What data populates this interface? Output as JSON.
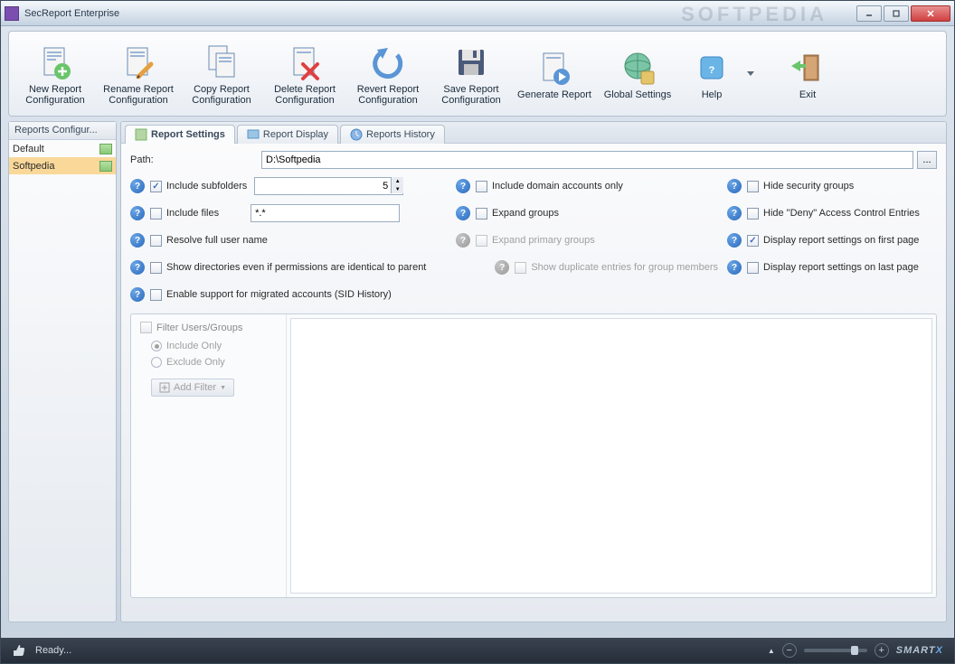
{
  "window": {
    "title": "SecReport Enterprise",
    "watermark": "SOFTPEDIA"
  },
  "toolbar": {
    "items": [
      {
        "label": "New Report Configuration"
      },
      {
        "label": "Rename Report Configuration"
      },
      {
        "label": "Copy Report Configuration"
      },
      {
        "label": "Delete Report Configuration"
      },
      {
        "label": "Revert Report Configuration"
      },
      {
        "label": "Save Report Configuration"
      },
      {
        "label": "Generate Report"
      },
      {
        "label": "Global Settings"
      },
      {
        "label": "Help"
      },
      {
        "label": "Exit"
      }
    ]
  },
  "sidebar": {
    "header": "Reports Configur...",
    "items": [
      {
        "label": "Default"
      },
      {
        "label": "Softpedia"
      }
    ]
  },
  "tabs": [
    {
      "label": "Report Settings"
    },
    {
      "label": "Report Display"
    },
    {
      "label": "Reports History"
    }
  ],
  "path": {
    "label": "Path:",
    "value": "D:\\Softpedia",
    "browse": "..."
  },
  "opts": {
    "include_subfolders": "Include subfolders",
    "subfolder_depth": "5",
    "include_files": "Include files",
    "files_pattern": "*.*",
    "resolve_name": "Resolve full user name",
    "show_identical": "Show directories even if permissions are identical to parent",
    "enable_sid": "Enable support for migrated accounts (SID History)",
    "domain_only": "Include domain accounts only",
    "expand_groups": "Expand  groups",
    "expand_primary": "Expand primary groups",
    "show_duplicate": "Show duplicate entries for group members",
    "hide_security": "Hide security groups",
    "hide_deny": "Hide \"Deny\" Access Control Entries",
    "display_first": "Display report settings on first page",
    "display_last": "Display report settings on last page"
  },
  "filter": {
    "title": "Filter Users/Groups",
    "include": "Include Only",
    "exclude": "Exclude Only",
    "add": "Add Filter"
  },
  "status": {
    "text": "Ready...",
    "brand": "SMART",
    "brand_x": "X"
  }
}
